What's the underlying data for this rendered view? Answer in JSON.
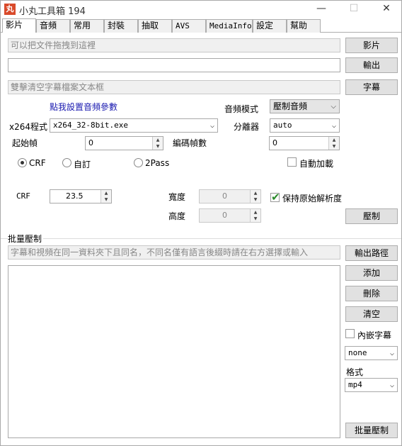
{
  "window": {
    "title": "小丸工具箱 194",
    "icon_text": "丸",
    "min": "—",
    "max": "☐",
    "close": "✕"
  },
  "tabs": [
    "影片",
    "音頻",
    "常用",
    "封裝",
    "抽取",
    "AVS",
    "MediaInfo",
    "設定",
    "幫助"
  ],
  "video": {
    "drop_placeholder": "可以把文件拖拽到這裡",
    "output_value": "",
    "subtitle_placeholder": "雙擊清空字幕檔案文本框",
    "btn_video": "影片",
    "btn_output": "輸出",
    "btn_subtitle": "字幕",
    "audio_settings_link": "點我設置音頻參數",
    "audio_mode_label": "音頻模式",
    "audio_mode_value": "壓制音頻",
    "x264_label": "x264程式",
    "x264_value": "x264_32-8bit.exe",
    "splitter_label": "分離器",
    "splitter_value": "auto",
    "start_frame_label": "起始幀",
    "start_frame_value": "0",
    "encode_frames_label": "編碼幀數",
    "encode_frames_value": "0",
    "mode_crf": "CRF",
    "mode_custom": "自訂",
    "mode_2pass": "2Pass",
    "auto_subtitle": "自動加載",
    "crf_label": "CRF",
    "crf_value": "23.5",
    "width_label": "寬度",
    "width_value": "0",
    "height_label": "高度",
    "height_value": "0",
    "keep_resolution": "保持原始解析度",
    "btn_encode": "壓制"
  },
  "batch": {
    "title": "批量壓制",
    "hint": "字幕和視頻在同一資料夾下且同名，不同名僅有語言後綴時請在右方選擇或輸入",
    "btn_output_path": "輸出路徑",
    "btn_add": "添加",
    "btn_delete": "刪除",
    "btn_clear": "清空",
    "embed_subtitle": "內嵌字幕",
    "subtitle_lang_value": "none",
    "format_label": "格式",
    "format_value": "mp4",
    "btn_batch_encode": "批量壓制"
  },
  "icons": {
    "dropdown": "chevron-down-icon",
    "spin_up": "▲",
    "spin_down": "▼",
    "check": "✔"
  }
}
